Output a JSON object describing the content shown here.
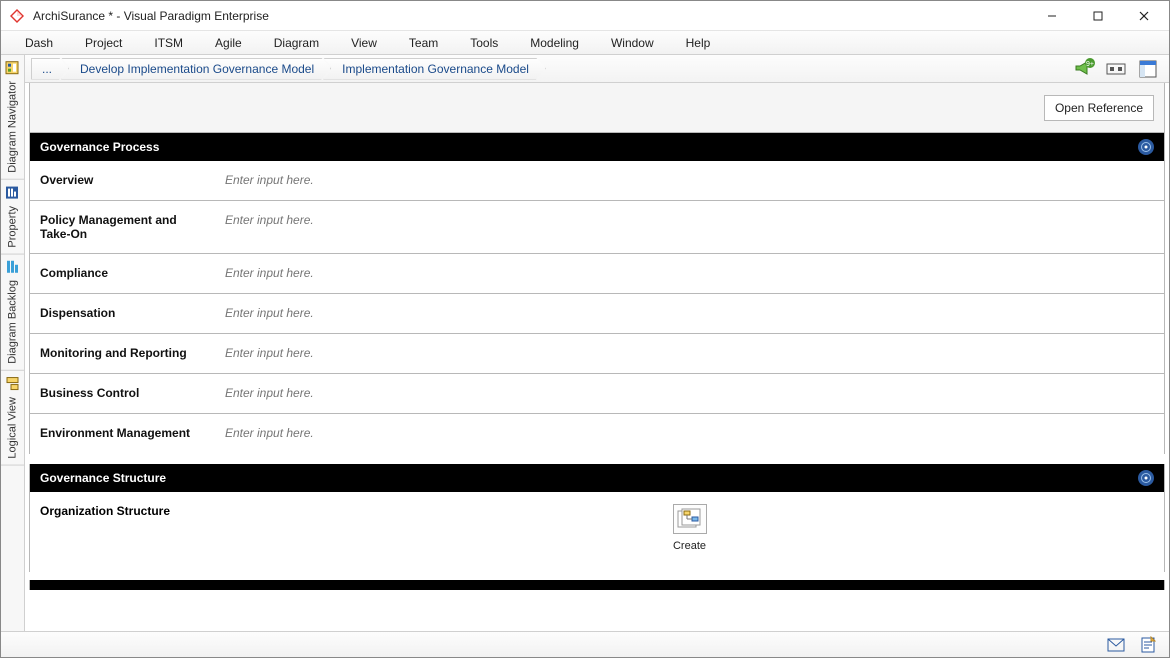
{
  "title": "ArchiSurance * - Visual Paradigm Enterprise",
  "menu": [
    "Dash",
    "Project",
    "ITSM",
    "Agile",
    "Diagram",
    "View",
    "Team",
    "Tools",
    "Modeling",
    "Window",
    "Help"
  ],
  "sidebar_tabs": [
    {
      "label": "Diagram Navigator",
      "icon": "navigator"
    },
    {
      "label": "Property",
      "icon": "property"
    },
    {
      "label": "Diagram Backlog",
      "icon": "backlog"
    },
    {
      "label": "Logical View",
      "icon": "logical"
    }
  ],
  "breadcrumbs": {
    "ellipsis": "...",
    "items": [
      "Develop Implementation Governance Model",
      "Implementation Governance Model"
    ]
  },
  "open_reference": "Open Reference",
  "sections": [
    {
      "title": "Governance Process",
      "rows": [
        {
          "label": "Overview",
          "placeholder": "Enter input here."
        },
        {
          "label": "Policy Management and Take-On",
          "placeholder": "Enter input here."
        },
        {
          "label": "Compliance",
          "placeholder": "Enter input here."
        },
        {
          "label": "Dispensation",
          "placeholder": "Enter input here."
        },
        {
          "label": "Monitoring and Reporting",
          "placeholder": "Enter input here."
        },
        {
          "label": "Business Control",
          "placeholder": "Enter input here."
        },
        {
          "label": "Environment Management",
          "placeholder": "Enter input here."
        }
      ]
    },
    {
      "title": "Governance Structure",
      "org": {
        "label": "Organization Structure",
        "create": "Create"
      }
    }
  ]
}
